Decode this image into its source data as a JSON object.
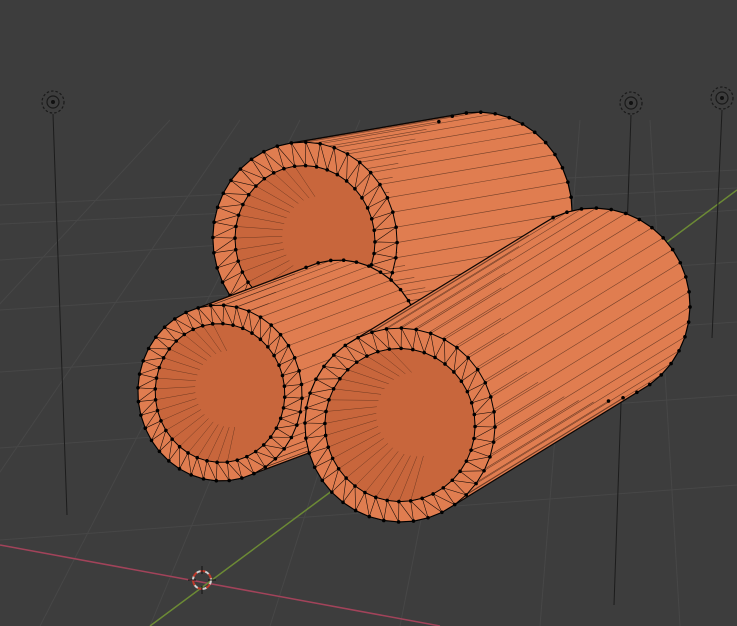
{
  "viewport": {
    "background_color": "#3d3d3d",
    "grid_color": "#474747",
    "x_axis_color": "#a2435a",
    "y_axis_color": "#6c8a35"
  },
  "scene": {
    "mesh_color": "#e07d50",
    "mesh_shade_color": "#c8663c",
    "wire_color": "#1a0d08",
    "vertex_color": "#000000",
    "objects": [
      {
        "name": "tube-top"
      },
      {
        "name": "tube-left"
      },
      {
        "name": "tube-right"
      }
    ],
    "lights": [
      {
        "name": "light-left"
      },
      {
        "name": "light-middle"
      },
      {
        "name": "light-right"
      }
    ],
    "icons": [
      "light-icon",
      "3d-cursor-icon"
    ]
  }
}
